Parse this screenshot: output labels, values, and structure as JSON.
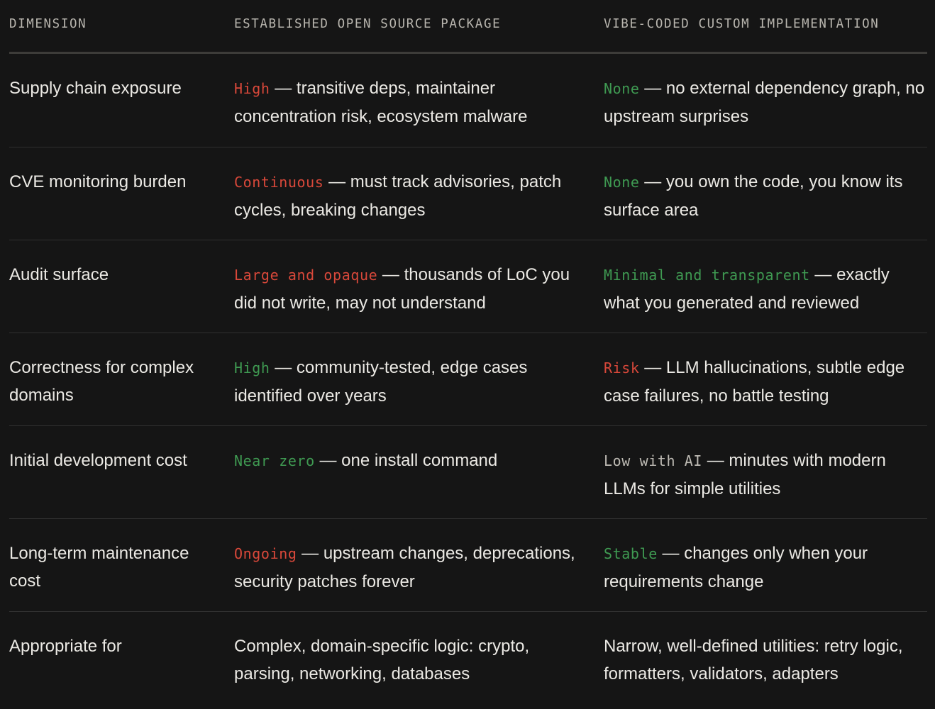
{
  "headers": {
    "dimension": "DIMENSION",
    "package": "ESTABLISHED OPEN SOURCE PACKAGE",
    "custom": "VIBE-CODED CUSTOM IMPLEMENTATION"
  },
  "colors": {
    "background": "#151515",
    "red": "#d9483a",
    "green": "#3f9a52",
    "grey": "#bdbab3"
  },
  "rows": [
    {
      "dimension": "Supply chain exposure",
      "package": {
        "tag": "High",
        "tag_color": "red",
        "text": " — transitive deps, maintainer concentration risk, ecosystem malware"
      },
      "custom": {
        "tag": "None",
        "tag_color": "green",
        "text": " — no external dependency graph, no upstream surprises"
      }
    },
    {
      "dimension": "CVE monitoring burden",
      "package": {
        "tag": "Continuous",
        "tag_color": "red",
        "text": " — must track advisories, patch cycles, breaking changes"
      },
      "custom": {
        "tag": "None",
        "tag_color": "green",
        "text": " — you own the code, you know its surface area"
      }
    },
    {
      "dimension": "Audit surface",
      "package": {
        "tag": "Large and opaque",
        "tag_color": "red",
        "text": " — thousands of LoC you did not write, may not understand"
      },
      "custom": {
        "tag": "Minimal and transparent",
        "tag_color": "green",
        "text": " — exactly what you generated and reviewed"
      }
    },
    {
      "dimension": "Correctness for complex domains",
      "package": {
        "tag": "High",
        "tag_color": "green",
        "text": " — community-tested, edge cases identified over years"
      },
      "custom": {
        "tag": "Risk",
        "tag_color": "red",
        "text": " — LLM hallucinations, subtle edge case failures, no battle testing"
      }
    },
    {
      "dimension": "Initial development cost",
      "package": {
        "tag": "Near zero",
        "tag_color": "green",
        "text": " — one install command"
      },
      "custom": {
        "tag": "Low with AI",
        "tag_color": "grey",
        "text": " — minutes with modern LLMs for simple utilities"
      }
    },
    {
      "dimension": "Long-term maintenance cost",
      "package": {
        "tag": "Ongoing",
        "tag_color": "red",
        "text": " — upstream changes, deprecations, security patches forever"
      },
      "custom": {
        "tag": "Stable",
        "tag_color": "green",
        "text": " — changes only when your requirements change"
      }
    },
    {
      "dimension": "Appropriate for",
      "package": {
        "tag": "",
        "tag_color": "",
        "text": "Complex, domain-specific logic: crypto, parsing, networking, databases"
      },
      "custom": {
        "tag": "",
        "tag_color": "",
        "text": "Narrow, well-defined utilities: retry logic, formatters, validators, adapters"
      }
    }
  ]
}
